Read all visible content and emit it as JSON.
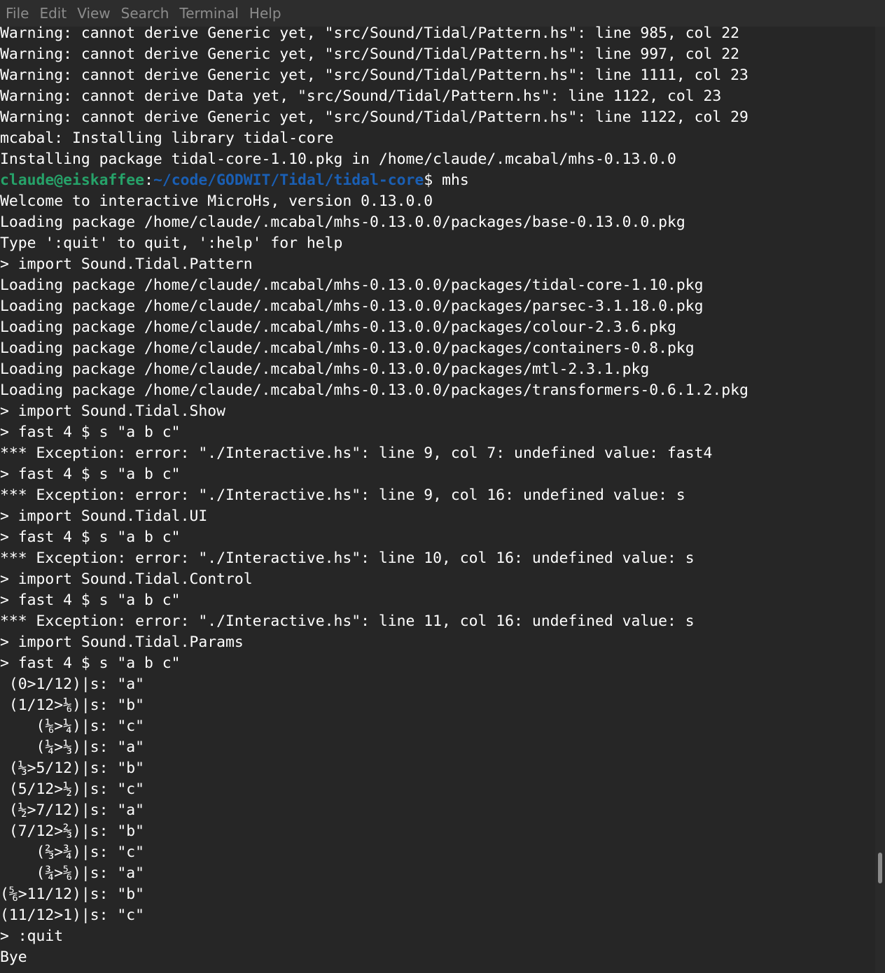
{
  "menu": {
    "items": [
      {
        "label": "File"
      },
      {
        "label": "Edit"
      },
      {
        "label": "View"
      },
      {
        "label": "Search"
      },
      {
        "label": "Terminal"
      },
      {
        "label": "Help"
      }
    ]
  },
  "terminal": {
    "lines_before": [
      "Warning: cannot derive Generic yet, \"src/Sound/Tidal/Pattern.hs\": line 985, col 22",
      "Warning: cannot derive Generic yet, \"src/Sound/Tidal/Pattern.hs\": line 997, col 22",
      "Warning: cannot derive Generic yet, \"src/Sound/Tidal/Pattern.hs\": line 1111, col 23",
      "Warning: cannot derive Data yet, \"src/Sound/Tidal/Pattern.hs\": line 1122, col 23",
      "Warning: cannot derive Generic yet, \"src/Sound/Tidal/Pattern.hs\": line 1122, col 29",
      "mcabal: Installing library tidal-core",
      "Installing package tidal-core-1.10.pkg in /home/claude/.mcabal/mhs-0.13.0.0"
    ],
    "prompt": {
      "user_host": "claude@eiskaffee",
      "separator": ":",
      "path": "~/code/GODWIT/Tidal/tidal-core",
      "dollar": "$",
      "command": " mhs"
    },
    "lines_after": [
      "Welcome to interactive MicroHs, version 0.13.0.0",
      "Loading package /home/claude/.mcabal/mhs-0.13.0.0/packages/base-0.13.0.0.pkg",
      "Type ':quit' to quit, ':help' for help",
      "> import Sound.Tidal.Pattern",
      "Loading package /home/claude/.mcabal/mhs-0.13.0.0/packages/tidal-core-1.10.pkg",
      "Loading package /home/claude/.mcabal/mhs-0.13.0.0/packages/parsec-3.1.18.0.pkg",
      "Loading package /home/claude/.mcabal/mhs-0.13.0.0/packages/colour-2.3.6.pkg",
      "Loading package /home/claude/.mcabal/mhs-0.13.0.0/packages/containers-0.8.pkg",
      "Loading package /home/claude/.mcabal/mhs-0.13.0.0/packages/mtl-2.3.1.pkg",
      "Loading package /home/claude/.mcabal/mhs-0.13.0.0/packages/transformers-0.6.1.2.pkg",
      "> import Sound.Tidal.Show",
      "> fast 4 $ s \"a b c\"",
      "*** Exception: error: \"./Interactive.hs\": line 9, col 7: undefined value: fast4",
      "> fast 4 $ s \"a b c\"",
      "*** Exception: error: \"./Interactive.hs\": line 9, col 16: undefined value: s",
      "> import Sound.Tidal.UI",
      "> fast 4 $ s \"a b c\"",
      "*** Exception: error: \"./Interactive.hs\": line 10, col 16: undefined value: s",
      "> import Sound.Tidal.Control",
      "> fast 4 $ s \"a b c\"",
      "*** Exception: error: \"./Interactive.hs\": line 11, col 16: undefined value: s",
      "> import Sound.Tidal.Params",
      "> fast 4 $ s \"a b c\"",
      " (0>1/12)|s: \"a\"",
      " (1/12>⅙)|s: \"b\"",
      "    (⅙>¼)|s: \"c\"",
      "    (¼>⅓)|s: \"a\"",
      " (⅓>5/12)|s: \"b\"",
      " (5/12>½)|s: \"c\"",
      " (½>7/12)|s: \"a\"",
      " (7/12>⅔)|s: \"b\"",
      "    (⅔>¾)|s: \"c\"",
      "    (¾>⅚)|s: \"a\"",
      "(⅚>11/12)|s: \"b\"",
      "(11/12>1)|s: \"c\"",
      "> :quit",
      "Bye"
    ]
  }
}
